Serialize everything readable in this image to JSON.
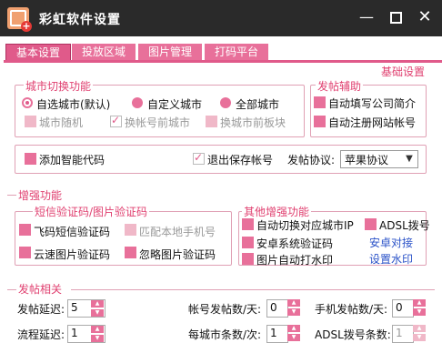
{
  "window": {
    "title": "彩虹软件设置"
  },
  "tabs": [
    {
      "label": "基本设置",
      "active": true
    },
    {
      "label": "投放区域",
      "active": false
    },
    {
      "label": "图片管理",
      "active": false
    },
    {
      "label": "打码平台",
      "active": false
    }
  ],
  "basic_settings_label": "基础设置",
  "city_switch": {
    "legend": "城市切换功能",
    "radios": [
      {
        "label": "自选城市(默认)",
        "selected": true
      },
      {
        "label": "自定义城市",
        "selected": false
      },
      {
        "label": "全部城市",
        "selected": false
      }
    ],
    "checks": [
      {
        "label": "城市随机",
        "checked": false,
        "disabled": true
      },
      {
        "label": "换帐号前城市",
        "checked": true,
        "disabled": true
      },
      {
        "label": "换城市前板块",
        "checked": false,
        "disabled": true
      }
    ]
  },
  "post_assist": {
    "legend": "发帖辅助",
    "checks": [
      {
        "label": "自动填写公司简介",
        "checked": false
      },
      {
        "label": "自动注册网站帐号",
        "checked": false
      }
    ]
  },
  "options_row": {
    "add_smart_code": "添加智能代码",
    "exit_save_account": "退出保存帐号",
    "exit_save_checked": true,
    "protocol_label": "发帖协议:",
    "protocol_value": "苹果协议"
  },
  "enhanced": {
    "title": "增强功能",
    "sms_captcha": {
      "legend": "短信验证码/图片验证码",
      "items": [
        {
          "label": "飞码短信验证码",
          "disabled": false
        },
        {
          "label": "匹配本地手机号",
          "disabled": true
        },
        {
          "label": "云速图片验证码",
          "disabled": false
        },
        {
          "label": "忽略图片验证码",
          "disabled": false
        }
      ]
    },
    "other": {
      "legend": "其他增强功能",
      "items": [
        {
          "label": "自动切换对应城市IP"
        },
        {
          "label": "ADSL拨号"
        },
        {
          "label": "安卓系统验证码"
        },
        {
          "label": "图片自动打水印"
        }
      ],
      "links": [
        "安卓对接",
        "设置水印"
      ]
    }
  },
  "posting": {
    "title": "发帖相关",
    "fields": [
      {
        "label": "发帖延迟:",
        "value": "5"
      },
      {
        "label": "帐号发帖数/天:",
        "value": "0"
      },
      {
        "label": "手机发帖数/天:",
        "value": "0"
      },
      {
        "label": "流程延迟:",
        "value": "1"
      },
      {
        "label": "每城市条数/次:",
        "value": "1"
      },
      {
        "label": "ADSL拨号条数:",
        "value": "1"
      }
    ]
  },
  "colors": {
    "accent": "#e05a8a",
    "titlebar": "#2a2a2a",
    "link": "#2a52c8"
  }
}
